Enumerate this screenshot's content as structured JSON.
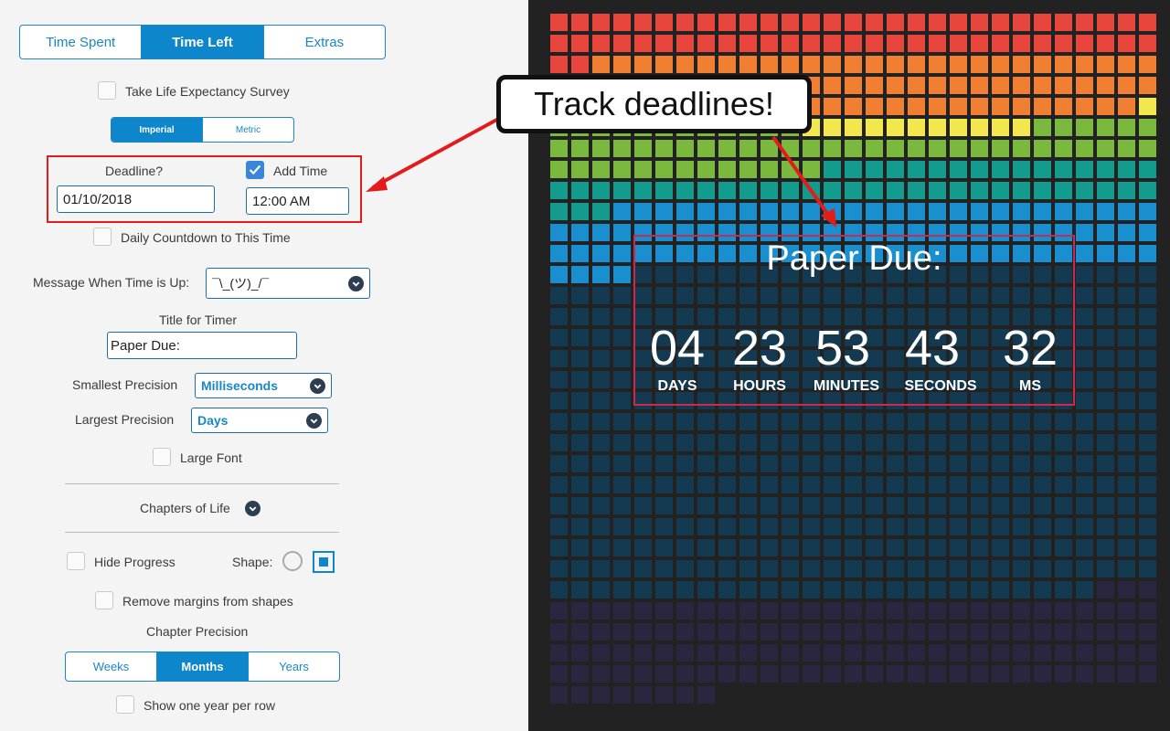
{
  "tabs": [
    {
      "label": "Time Spent",
      "active": false
    },
    {
      "label": "Time Left",
      "active": true
    },
    {
      "label": "Extras",
      "active": false
    }
  ],
  "survey_label": "Take Life Expectancy Survey",
  "units": [
    {
      "label": "Imperial",
      "active": true
    },
    {
      "label": "Metric",
      "active": false
    }
  ],
  "deadline": {
    "label": "Deadline?",
    "value": "01/10/2018",
    "add_time_label": "Add Time",
    "add_time_checked": true,
    "time_value": "12:00 AM"
  },
  "daily_countdown_label": "Daily Countdown to This Time",
  "message": {
    "label": "Message When Time is Up:",
    "value": "¯\\_(ツ)_/¯"
  },
  "title_for_timer": {
    "label": "Title for Timer",
    "value": "Paper Due:"
  },
  "smallest_precision": {
    "label": "Smallest Precision",
    "value": "Milliseconds"
  },
  "largest_precision": {
    "label": "Largest Precision",
    "value": "Days"
  },
  "large_font_label": "Large Font",
  "chapters_label": "Chapters of Life",
  "hide_progress_label": "Hide Progress",
  "shape_label": "Shape:",
  "remove_margins_label": "Remove margins from shapes",
  "chapter_precision": {
    "label": "Chapter Precision",
    "options": [
      {
        "label": "Weeks",
        "active": false
      },
      {
        "label": "Months",
        "active": true
      },
      {
        "label": "Years",
        "active": false
      }
    ]
  },
  "one_year_label": "Show one year per row",
  "timer": {
    "title": "Paper Due:",
    "units": [
      {
        "value": "04",
        "label": "DAYS"
      },
      {
        "value": "23",
        "label": "HOURS"
      },
      {
        "value": "53",
        "label": "MINUTES"
      },
      {
        "value": "43",
        "label": "SECONDS"
      },
      {
        "value": "32",
        "label": "MS"
      }
    ]
  },
  "callout_text": "Track deadlines!",
  "colors": {
    "accent": "#0e86cc",
    "highlight_red": "#e31b1b",
    "timer_border": "#d2284f",
    "row_colors": [
      "#e8453c",
      "#e8453c",
      "#f07f32",
      "#f07f32",
      "#f07f32",
      "#f2e84d",
      "#7bb83e",
      "#7bb83e",
      "#139b8e",
      "#139b8e",
      "#1a8fd0",
      "#1a8fd0",
      "#1a8fd0",
      "#143a52",
      "#2a2640"
    ]
  }
}
